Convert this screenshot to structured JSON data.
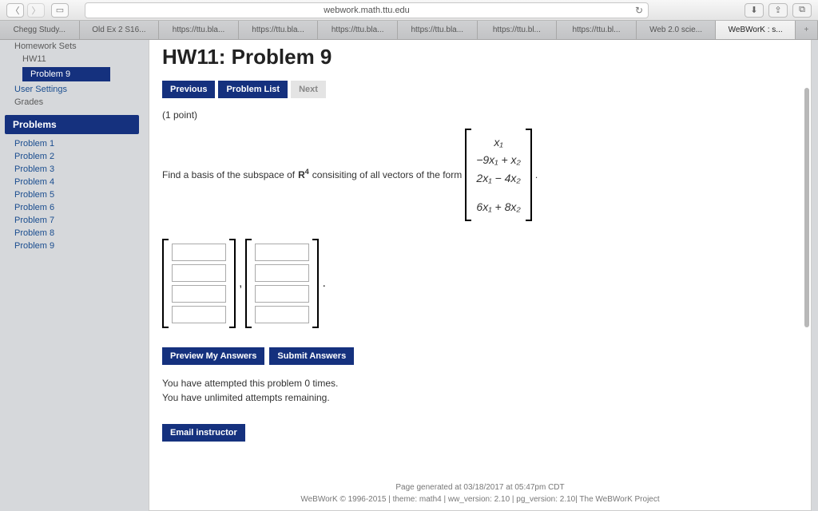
{
  "browser": {
    "url": "webwork.math.ttu.edu",
    "tabs": [
      "Chegg Study...",
      "Old Ex 2 S16...",
      "https://ttu.bla...",
      "https://ttu.bla...",
      "https://ttu.bla...",
      "https://ttu.bla...",
      "https://ttu.bl...",
      "https://ttu.bl...",
      "Web 2.0 scie...",
      "WeBWorK : s..."
    ]
  },
  "sidebar": {
    "sets": "Homework Sets",
    "hw": "HW11",
    "current": "Problem 9",
    "settings": "User Settings",
    "grades": "Grades",
    "problems_header": "Problems",
    "problems": [
      "Problem 1",
      "Problem 2",
      "Problem 3",
      "Problem 4",
      "Problem 5",
      "Problem 6",
      "Problem 7",
      "Problem 8",
      "Problem 9"
    ]
  },
  "content": {
    "title": "HW11: Problem 9",
    "prev": "Previous",
    "list": "Problem List",
    "next": "Next",
    "points": "(1 point)",
    "question_lead": "Find a basis of the subspace of ",
    "question_space": "R",
    "question_exp": "4",
    "question_tail": " consisiting of all vectors of the form",
    "vec": [
      "x₁",
      "−9x₁ + x₂",
      "2x₁ − 4x₂",
      "",
      "6x₁ + 8x₂"
    ],
    "comma": ",",
    "period": ".",
    "preview": "Preview My Answers",
    "submit": "Submit Answers",
    "attempts1": "You have attempted this problem 0 times.",
    "attempts2": "You have unlimited attempts remaining.",
    "email": "Email instructor",
    "footer1": "Page generated at 03/18/2017 at 05:47pm CDT",
    "footer2": "WeBWorK © 1996-2015 | theme: math4 | ww_version: 2.10 | pg_version: 2.10| The WeBWorK Project"
  }
}
